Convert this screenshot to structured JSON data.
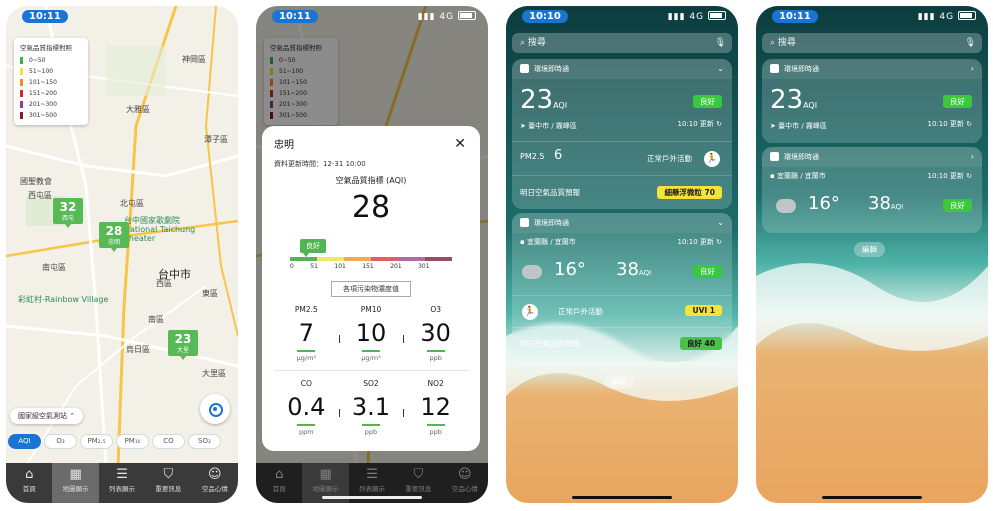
{
  "status": {
    "time": "10:11",
    "time_widget": "10:10",
    "network": "4G"
  },
  "map_screen": {
    "legend": {
      "title": "空氣品質指標對照",
      "items": [
        {
          "range": "0~50",
          "color": "#3fb23f"
        },
        {
          "range": "51~100",
          "color": "#f1e33a"
        },
        {
          "range": "101~150",
          "color": "#f08a24"
        },
        {
          "range": "151~200",
          "color": "#d7262a"
        },
        {
          "range": "201~300",
          "color": "#8e3b91"
        },
        {
          "range": "301~500",
          "color": "#7d1c2c"
        }
      ]
    },
    "labels": {
      "shengang": "神岡區",
      "daya": "大雅區",
      "tanzi": "潭子區",
      "guosheng": "國聖教會",
      "xitun": "西屯區",
      "beitun": "北屯區",
      "theater": "台中國家歌劇院 National Taichung Theater",
      "nantun": "南屯區",
      "taichung": "台中市",
      "rainbow": "彩虹村-Rainbow Village",
      "dongqu": "東區",
      "nanqu": "南區",
      "wuri": "烏日區",
      "dali": "大里區",
      "xi": "西區"
    },
    "markers": [
      {
        "value": "32",
        "name": "西屯"
      },
      {
        "value": "28",
        "name": "忠明"
      },
      {
        "value": "23",
        "name": "大里"
      }
    ],
    "station_button": "國家級空氣測站",
    "pollutant_tabs": [
      "AQI",
      "O₃",
      "PM₂.₅",
      "PM₁₀",
      "CO",
      "SO₂"
    ]
  },
  "tabbar": [
    {
      "label": "首頁",
      "icon": "home-icon"
    },
    {
      "label": "地圖顯示",
      "icon": "map-icon"
    },
    {
      "label": "列表顯示",
      "icon": "list-icon"
    },
    {
      "label": "重要訊息",
      "icon": "shield-icon"
    },
    {
      "label": "空品心情",
      "icon": "smile-icon"
    }
  ],
  "detail": {
    "station": "忠明",
    "updated": "資料更新時間：12-31 10:00",
    "aqi_title": "空氣品質指標 (AQI)",
    "aqi_value": "28",
    "status": "良好",
    "scale_ticks": [
      "0",
      "51",
      "101",
      "151",
      "201",
      "301"
    ],
    "section_title": "各項污染物濃度值",
    "pollutants": [
      {
        "name": "PM2.5",
        "value": "7",
        "unit": "μg/m³"
      },
      {
        "name": "PM10",
        "value": "10",
        "unit": "μg/m³"
      },
      {
        "name": "O3",
        "value": "30",
        "unit": "ppb"
      },
      {
        "name": "CO",
        "value": "0.4",
        "unit": "ppm"
      },
      {
        "name": "SO2",
        "value": "3.1",
        "unit": "ppb"
      },
      {
        "name": "NO2",
        "value": "12",
        "unit": "ppb"
      }
    ]
  },
  "widgets": {
    "search": "搜尋",
    "app_name": "環境即時通",
    "w1": {
      "aqi": "23",
      "aqi_unit": "AQI",
      "location": "臺中市 / 霧峰區",
      "updated": "10:10 更新",
      "status": "良好",
      "pm_label": "PM2.5",
      "pm_value": "6",
      "outdoor": "正常戶外活動",
      "forecast_label": "明日空氣品質預報",
      "forecast": "細懸浮微粒 70"
    },
    "w2": {
      "location": "宜蘭縣 / 宜蘭市",
      "updated": "10:10 更新",
      "temp": "16°",
      "aqi": "38",
      "aqi_unit": "AQI",
      "status": "良好",
      "outdoor": "正常戶外活動",
      "uvi": "UVI 1",
      "forecast_label": "明日空氣品質預報",
      "forecast": "良好 40"
    },
    "edit": "編輯"
  }
}
